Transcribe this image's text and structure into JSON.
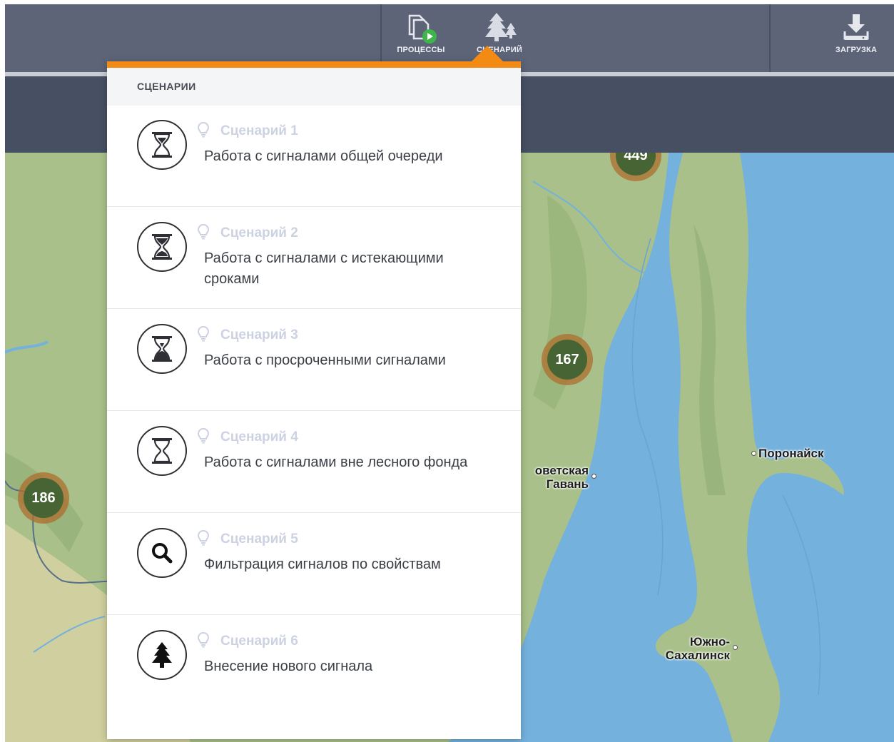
{
  "toolbar": {
    "processes_label": "ПРОЦЕССЫ",
    "scenarios_label": "СЦЕНАРИЙ",
    "download_label": "ЗАГРУЗКА",
    "processes_icon": "documents-play-icon",
    "scenarios_icon": "trees-icon",
    "download_icon": "download-icon"
  },
  "dropdown": {
    "header": "СЦЕНАРИИ",
    "accent_color": "#f28a13",
    "items": [
      {
        "title": "Сценарий 1",
        "description": "Работа с сигналами общей очереди",
        "icon": "hourglass-empty-icon"
      },
      {
        "title": "Сценарий 2",
        "description": "Работа с сигналами с истекающими сроками",
        "icon": "hourglass-half-icon"
      },
      {
        "title": "Сценарий 3",
        "description": "Работа с просроченными сигналами",
        "icon": "hourglass-full-icon"
      },
      {
        "title": "Сценарий 4",
        "description": "Работа с сигналами вне лесного фонда",
        "icon": "hourglass-outline-icon"
      },
      {
        "title": "Сценарий 5",
        "description": "Фильтрация сигналов по свойствам",
        "icon": "search-icon"
      },
      {
        "title": "Сценарий 6",
        "description": "Внесение нового сигнала",
        "icon": "tree-icon"
      }
    ]
  },
  "map": {
    "clusters": [
      "449",
      "167",
      "186"
    ],
    "cities": {
      "sovetskaya": "оветская\nГавань",
      "poronaysk": "Поронайск",
      "yuzhno": "Южно-\nСахалинск"
    },
    "water_color": "#74b1dc",
    "land_color": "#a9c08a"
  }
}
